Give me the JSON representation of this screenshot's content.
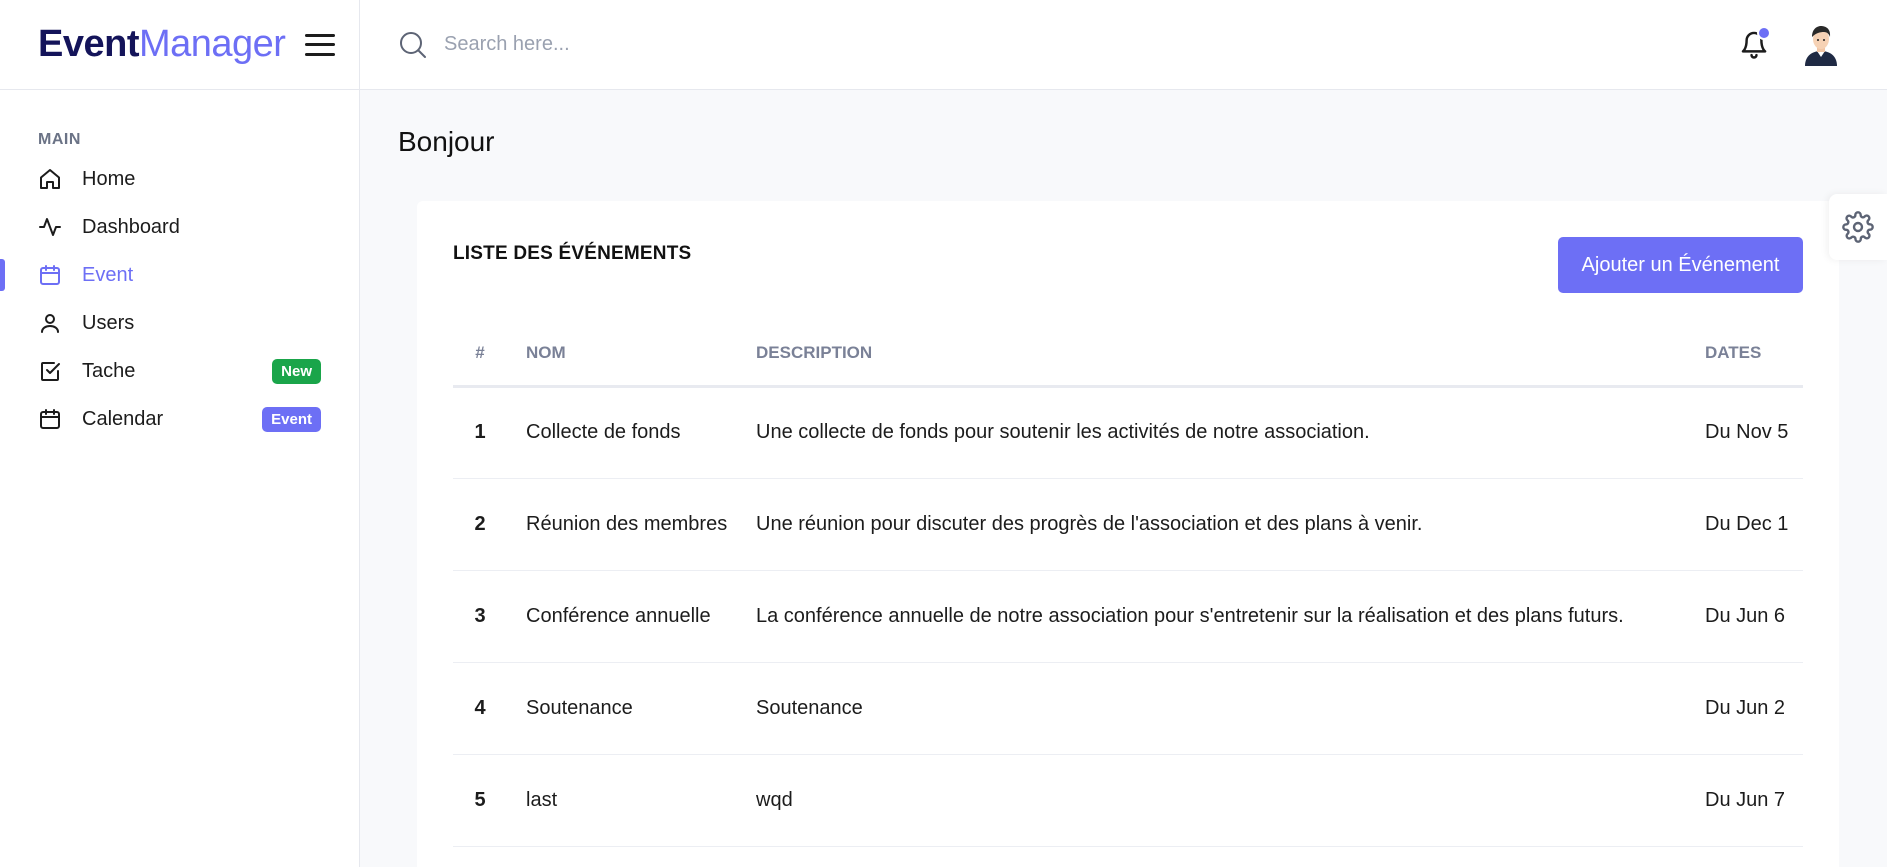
{
  "brand": {
    "part1": "Event",
    "part2": "Manager"
  },
  "sidebar": {
    "section": "MAIN",
    "items": [
      {
        "label": "Home",
        "icon": "home-icon"
      },
      {
        "label": "Dashboard",
        "icon": "activity-icon"
      },
      {
        "label": "Event",
        "icon": "calendar-icon",
        "active": true
      },
      {
        "label": "Users",
        "icon": "user-icon"
      },
      {
        "label": "Tache",
        "icon": "checkbox-icon",
        "badge": "New",
        "badge_color": "#1aa54a"
      },
      {
        "label": "Calendar",
        "icon": "calendar-icon",
        "badge": "Event",
        "badge_color": "#6d6ff5"
      }
    ]
  },
  "header": {
    "search_placeholder": "Search here..."
  },
  "main": {
    "title": "Bonjour",
    "card_title": "LISTE DES ÉVÉNEMENTS",
    "add_button": "Ajouter un Événement",
    "table": {
      "headers": [
        "#",
        "NOM",
        "DESCRIPTION",
        "DATES"
      ],
      "rows": [
        [
          "1",
          "Collecte de fonds",
          "Une collecte de fonds pour soutenir les activités de notre association.",
          "Du Nov 5"
        ],
        [
          "2",
          "Réunion des membres",
          "Une réunion pour discuter des progrès de l'association et des plans à venir.",
          "Du Dec 1"
        ],
        [
          "3",
          "Conférence annuelle",
          "La conférence annuelle de notre association pour s'entretenir sur la réalisation et des plans futurs.",
          "Du Jun 6"
        ],
        [
          "4",
          "Soutenance",
          "Soutenance",
          "Du Jun 2"
        ],
        [
          "5",
          "last",
          "wqd",
          "Du Jun 7"
        ]
      ]
    }
  },
  "colors": {
    "accent": "#6d6ff5",
    "brand_dark": "#14145a",
    "badge_green": "#1aa54a"
  }
}
